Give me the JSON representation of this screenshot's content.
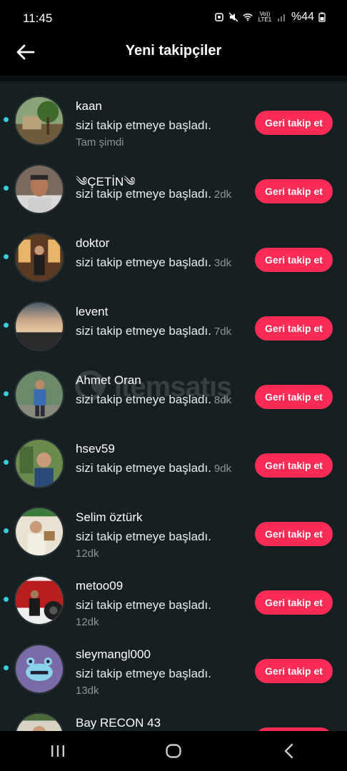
{
  "status_bar": {
    "time": "11:45",
    "network_label": "Vo)) LTE1",
    "battery": "%44"
  },
  "header": {
    "title": "Yeni takipçiler"
  },
  "colors": {
    "accent": "#fe2c55",
    "unread_dot": "#3cc9dc",
    "background": "#161f21"
  },
  "watermark": {
    "text": "itemsatış"
  },
  "followers": [
    {
      "name": "kaan",
      "message": "sizi takip etmeye başladı.",
      "time": "Tam şimdi",
      "time_inline": false,
      "button": "Geri takip et"
    },
    {
      "name": "༄ÇETİN༄",
      "message": "sizi takip etmeye başladı.",
      "time": "2dk",
      "time_inline": true,
      "button": "Geri takip et"
    },
    {
      "name": "doktor",
      "message": "sizi takip etmeye başladı.",
      "time": "3dk",
      "time_inline": true,
      "button": "Geri takip et"
    },
    {
      "name": "levent",
      "message": "sizi takip etmeye başladı.",
      "time": "7dk",
      "time_inline": true,
      "button": "Geri takip et"
    },
    {
      "name": "Ahmet Oran",
      "message": "sizi takip etmeye başladı.",
      "time": "8dk",
      "time_inline": true,
      "button": "Geri takip et"
    },
    {
      "name": "hsev59",
      "message": "sizi takip etmeye başladı.",
      "time": "9dk",
      "time_inline": true,
      "button": "Geri takip et"
    },
    {
      "name": "Selim öztürk",
      "message": "sizi takip etmeye başladı.",
      "time": "12dk",
      "time_inline": false,
      "button": "Geri takip et"
    },
    {
      "name": "metoo09",
      "message": "sizi takip etmeye başladı.",
      "time": "12dk",
      "time_inline": false,
      "button": "Geri takip et"
    },
    {
      "name": "sleymangl000",
      "message": "sizi takip etmeye başladı.",
      "time": "13dk",
      "time_inline": false,
      "button": "Geri takip et"
    },
    {
      "name": "Bay RECON 43",
      "message": "",
      "time": "",
      "time_inline": false,
      "button": ""
    }
  ]
}
